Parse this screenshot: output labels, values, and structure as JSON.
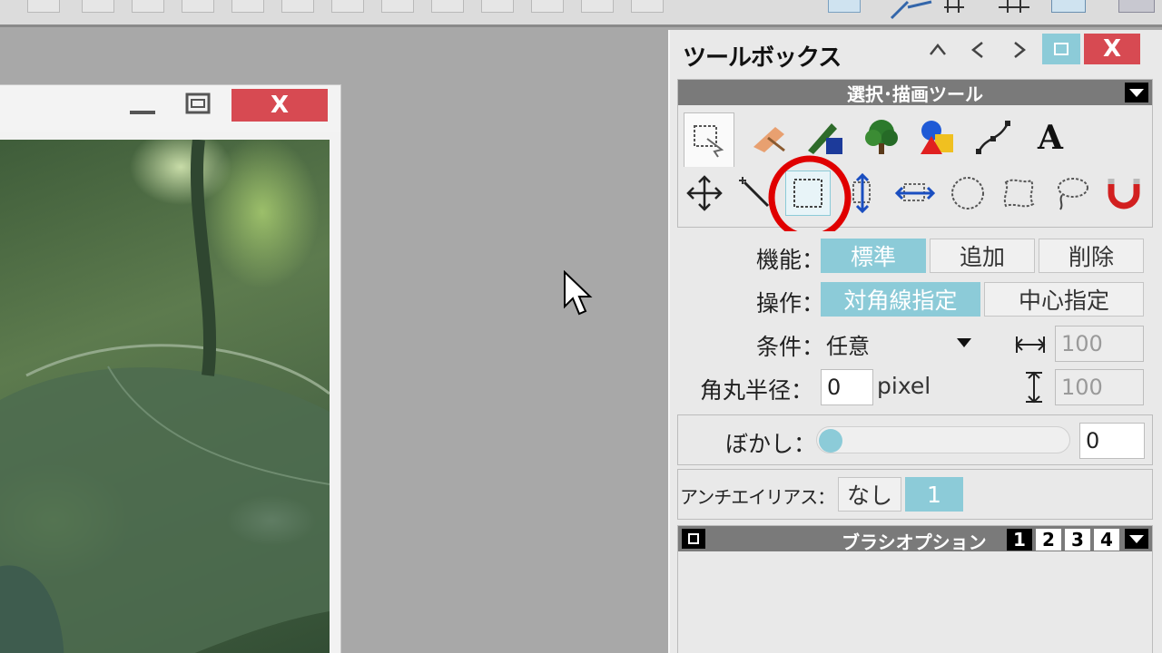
{
  "toolbox": {
    "title": "ツールボックス",
    "section_title": "選択･描画ツール",
    "function_label": "機能：",
    "function_options": [
      "標準",
      "追加",
      "削除"
    ],
    "operation_label": "操作：",
    "operation_options": [
      "対角線指定",
      "中心指定"
    ],
    "condition_label": "条件：",
    "condition_value": "任意",
    "width_value": "100",
    "height_value": "100",
    "radius_label": "角丸半径：",
    "radius_value": "0",
    "radius_unit": "pixel",
    "blur_label": "ぼかし：",
    "blur_value": "0",
    "antialias_label": "アンチエイリアス：",
    "antialias_options": [
      "なし",
      "1"
    ],
    "brush_section_title": "ブラシオプション",
    "brush_tabs": [
      "1",
      "2",
      "3",
      "4"
    ],
    "tool_tabs": [
      "select-tool-tab",
      "paint-tool-tab",
      "pen-tool-tab",
      "tree-tool-tab",
      "shapes-tool-tab",
      "curve-tool-tab",
      "text-tool-tab"
    ],
    "text_tab_glyph": "A"
  },
  "image_window": {
    "close_glyph": "X"
  },
  "colors": {
    "accent": "#8ccbd8",
    "highlight_circle": "#e00000",
    "close_button": "#d74a52"
  }
}
